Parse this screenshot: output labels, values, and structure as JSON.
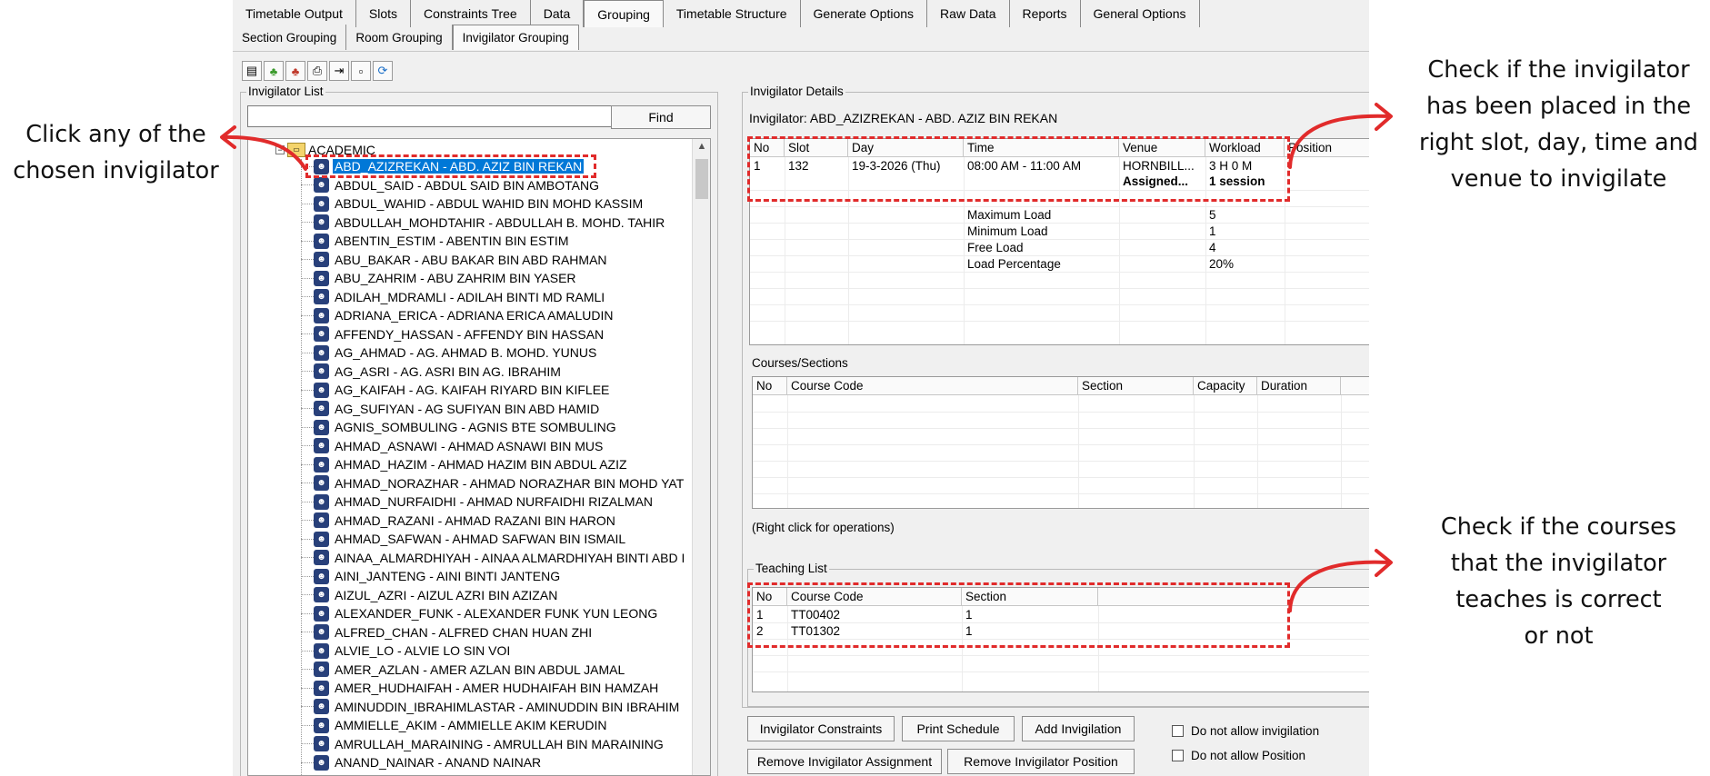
{
  "tabs_main": [
    "Timetable Output",
    "Slots",
    "Constraints Tree",
    "Data",
    "Grouping",
    "Timetable Structure",
    "Generate Options",
    "Raw Data",
    "Reports",
    "General Options"
  ],
  "tabs_main_active": "Grouping",
  "tabs_sub": [
    "Section Grouping",
    "Room Grouping",
    "Invigilator Grouping"
  ],
  "tabs_sub_active": "Invigilator Grouping",
  "toolbar_icons": [
    "open-folder-icon",
    "add-user-icon",
    "remove-user-icon",
    "print-icon",
    "export-icon",
    "toggle-icon",
    "refresh-icon"
  ],
  "invigilator_list": {
    "title": "Invigilator List",
    "find_label": "Find",
    "search_value": "",
    "root": "ACADEMIC",
    "items": [
      "ABD_AZIZREKAN - ABD. AZIZ BIN REKAN",
      "ABDUL_SAID - ABDUL SAID BIN AMBOTANG",
      "ABDUL_WAHID - ABDUL WAHID BIN MOHD KASSIM",
      "ABDULLAH_MOHDTAHIR - ABDULLAH B. MOHD. TAHIR",
      "ABENTIN_ESTIM - ABENTIN BIN ESTIM",
      "ABU_BAKAR - ABU BAKAR BIN ABD RAHMAN",
      "ABU_ZAHRIM - ABU ZAHRIM BIN YASER",
      "ADILAH_MDRAMLI - ADILAH BINTI MD RAMLI",
      "ADRIANA_ERICA - ADRIANA ERICA AMALUDIN",
      "AFFENDY_HASSAN - AFFENDY BIN HASSAN",
      "AG_AHMAD - AG. AHMAD B. MOHD. YUNUS",
      "AG_ASRI - AG. ASRI BIN AG. IBRAHIM",
      "AG_KAIFAH - AG. KAIFAH RIYARD BIN KIFLEE",
      "AG_SUFIYAN - AG SUFIYAN BIN ABD HAMID",
      "AGNIS_SOMBULING - AGNIS BTE SOMBULING",
      "AHMAD_ASNAWI - AHMAD ASNAWI BIN MUS",
      "AHMAD_HAZIM - AHMAD HAZIM BIN ABDUL AZIZ",
      "AHMAD_NORAZHAR - AHMAD NORAZHAR BIN MOHD YAT",
      "AHMAD_NURFAIDHI - AHMAD NURFAIDHI RIZALMAN",
      "AHMAD_RAZANI - AHMAD RAZANI BIN HARON",
      "AHMAD_SAFWAN - AHMAD SAFWAN BIN ISMAIL",
      "AINAA_ALMARDHIYAH - AINAA ALMARDHIYAH BINTI ABD I",
      "AINI_JANTENG - AINI BINTI JANTENG",
      "AIZUL_AZRI - AIZUL AZRI BIN AZIZAN",
      "ALEXANDER_FUNK - ALEXANDER FUNK YUN LEONG",
      "ALFRED_CHAN - ALFRED CHAN HUAN ZHI",
      "ALVIE_LO - ALVIE LO SIN VOI",
      "AMER_AZLAN - AMER AZLAN BIN ABDUL JAMAL",
      "AMER_HUDHAIFAH - AMER HUDHAIFAH BIN HAMZAH",
      "AMINUDDIN_IBRAHIMLASTAR - AMINUDDIN BIN  IBRAHIM",
      "AMMIELLE_AKIM - AMMIELLE AKIM KERUDIN",
      "AMRULLAH_MARAINING - AMRULLAH BIN MARAINING",
      "ANAND_NAINAR - ANAND NAINAR"
    ]
  },
  "details": {
    "title": "Invigilator Details",
    "invigilator_label": "Invigilator: ABD_AZIZREKAN - ABD. AZIZ BIN REKAN",
    "columns": [
      "No",
      "Slot",
      "Day",
      "Time",
      "Venue",
      "Workload",
      "Position"
    ],
    "row": [
      "1",
      "132",
      "19-3-2026 (Thu)",
      "08:00 AM - 11:00 AM",
      "HORNBILL...",
      "3 H 0 M",
      "-"
    ],
    "row2": [
      "Assigned...",
      "1 session"
    ],
    "load_labels": [
      "Maximum Load",
      "Minimum Load",
      "Free Load",
      "Load Percentage"
    ],
    "load_values": [
      "5",
      "1",
      "4",
      "20%"
    ]
  },
  "courses": {
    "title": "Courses/Sections",
    "columns": [
      "No",
      "Course Code",
      "Section",
      "Capacity",
      "Duration"
    ],
    "note": "(Right click for operations)"
  },
  "teaching": {
    "title": "Teaching List",
    "columns": [
      "No",
      "Course Code",
      "Section"
    ],
    "rows": [
      [
        "1",
        "TT00402",
        "1"
      ],
      [
        "2",
        "TT01302",
        "1"
      ]
    ]
  },
  "buttons": {
    "constraints": "Invigilator Constraints",
    "print": "Print Schedule",
    "add": "Add Invigilation",
    "remove_assignment": "Remove Invigilator Assignment",
    "remove_position": "Remove Invigilator Position"
  },
  "checkboxes": [
    "Do not allow invigilation",
    "Do not allow Position"
  ],
  "annotations": {
    "left": [
      "Click any of the",
      "chosen invigilator"
    ],
    "right_top": [
      "Check if the invigilator",
      "has been placed in the",
      "right slot, day, time and",
      "venue to invigilate"
    ],
    "right_bottom": [
      "Check if the courses",
      "that the invigilator",
      "teaches is correct",
      "or not"
    ],
    "accent": "#e12b2b"
  }
}
